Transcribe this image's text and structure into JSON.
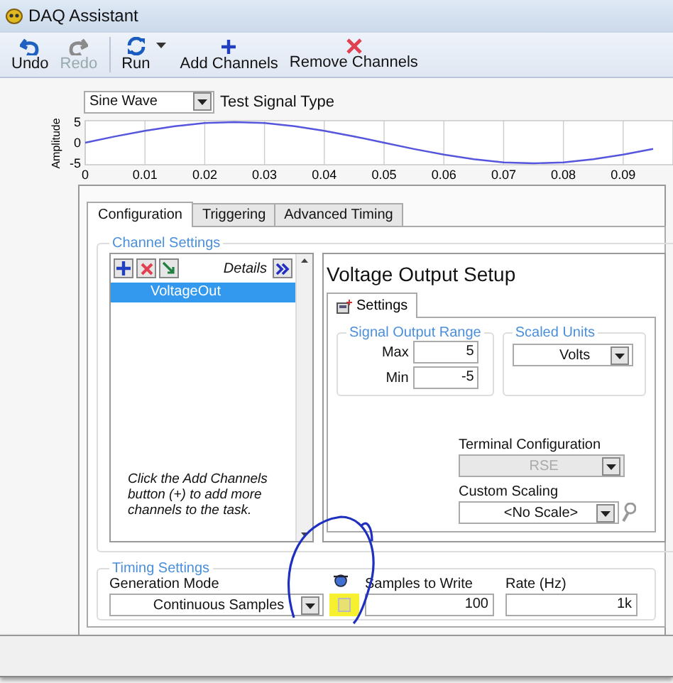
{
  "window": {
    "title": "DAQ Assistant"
  },
  "toolbar": [
    {
      "label": "Undo",
      "kind": "undo",
      "disabled": false
    },
    {
      "label": "Redo",
      "kind": "redo",
      "disabled": true
    },
    {
      "label": "Run",
      "kind": "run",
      "disabled": false
    },
    {
      "label": "Add Channels",
      "kind": "add",
      "disabled": false
    },
    {
      "label": "Remove Channels",
      "kind": "remove",
      "disabled": false
    }
  ],
  "signal": {
    "value": "Sine Wave",
    "label": "Test Signal Type"
  },
  "preview": {
    "chart_data": {
      "type": "line",
      "grid": true,
      "ylabel": "Amplitude",
      "xlim": [
        0,
        0.098
      ],
      "ylim": [
        -5,
        5
      ],
      "xticks": [
        0,
        0.01,
        0.02,
        0.03,
        0.04,
        0.05,
        0.06,
        0.07,
        0.08,
        0.09
      ],
      "yticks": [
        -5,
        0,
        5
      ],
      "x": [
        0,
        0.005,
        0.01,
        0.015,
        0.02,
        0.025,
        0.03,
        0.035,
        0.04,
        0.045,
        0.05,
        0.055,
        0.06,
        0.065,
        0.07,
        0.075,
        0.08,
        0.085,
        0.09,
        0.095
      ],
      "series": [
        {
          "color": "#5555dd",
          "values": [
            0,
            1.5,
            2.9,
            4,
            4.8,
            5,
            4.8,
            4,
            2.9,
            1.5,
            0,
            -1.5,
            -2.9,
            -4,
            -4.8,
            -5,
            -4.8,
            -4,
            -2.9,
            -1.5
          ]
        }
      ]
    }
  },
  "tabs": [
    {
      "label": "Configuration",
      "selected": true
    },
    {
      "label": "Triggering",
      "selected": false
    },
    {
      "label": "Advanced Timing",
      "selected": false
    }
  ],
  "channel_settings": {
    "title": "Channel Settings",
    "details_label": "Details",
    "channels": [
      {
        "name": "VoltageOut",
        "selected": true
      }
    ],
    "hint": "Click the Add Channels button (+) to add more channels to the task."
  },
  "setup": {
    "title": "Voltage Output Setup",
    "tabs": [
      {
        "label": "Settings",
        "selected": true
      }
    ],
    "range": {
      "title": "Signal Output Range",
      "max_label": "Max",
      "max": "5",
      "min_label": "Min",
      "min": "-5"
    },
    "scaled_units": {
      "title": "Scaled Units",
      "value": "Volts"
    },
    "terminal": {
      "label": "Terminal Configuration",
      "value": "RSE",
      "disabled": true
    },
    "scaling": {
      "label": "Custom Scaling",
      "value": "<No Scale>"
    }
  },
  "timing": {
    "title": "Timing Settings",
    "mode_label": "Generation Mode",
    "mode": "Continuous Samples",
    "samples_label": "Samples to Write",
    "samples": "100",
    "rate_label": "Rate (Hz)",
    "rate": "1k"
  }
}
